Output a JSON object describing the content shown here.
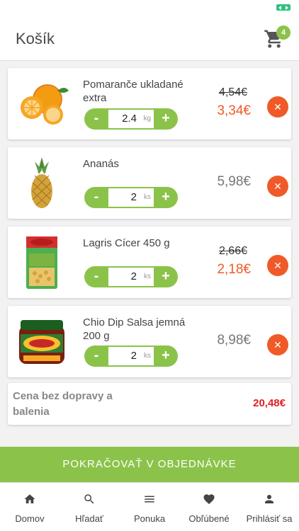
{
  "app": {
    "title": "Košík",
    "cart_count": "4"
  },
  "items": [
    {
      "name": "Pomaranče ukladané extra",
      "qty": "2.4",
      "unit": "kg",
      "old_price": "4,54€",
      "price": "3,34€",
      "thumb": "oranges"
    },
    {
      "name": "Ananás",
      "qty": "2",
      "unit": "ks",
      "price": "5,98€",
      "thumb": "pineapple"
    },
    {
      "name": "Lagris Cícer 450 g",
      "qty": "2",
      "unit": "ks",
      "old_price": "2,66€",
      "price": "2,18€",
      "thumb": "chickpeas-bag"
    },
    {
      "name": "Chio Dip Salsa jemná 200 g",
      "qty": "2",
      "unit": "ks",
      "price": "8,98€",
      "thumb": "salsa-jar"
    }
  ],
  "buttons": {
    "minus": "-",
    "plus": "+",
    "remove": "✕"
  },
  "summary": {
    "label": "Cena bez dopravy a balenia",
    "total": "20,48€"
  },
  "continue_label": "POKRAČOVAŤ V OBJEDNÁVKE",
  "nav": [
    {
      "label": "Domov",
      "icon": "home-icon"
    },
    {
      "label": "Hľadať",
      "icon": "search-icon"
    },
    {
      "label": "Ponuka",
      "icon": "menu-icon"
    },
    {
      "label": "Obľúbené",
      "icon": "heart-icon"
    },
    {
      "label": "Prihlásiť sa",
      "icon": "person-icon"
    }
  ],
  "colors": {
    "accent": "#8bc34a",
    "remove": "#f05a28",
    "sale": "#f05a28",
    "total": "#e02020"
  }
}
